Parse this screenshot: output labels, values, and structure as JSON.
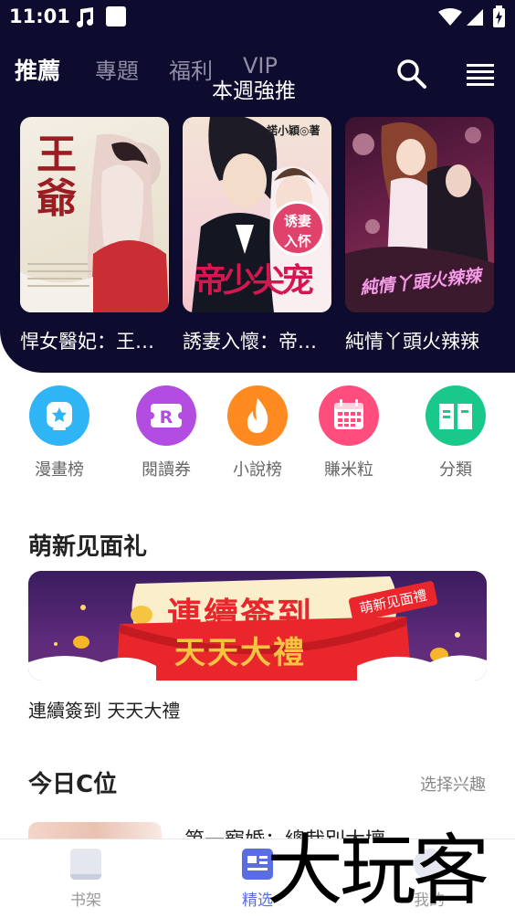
{
  "status_bar": {
    "time": "11:01"
  },
  "top_tabs": [
    {
      "label": "推薦",
      "active": true
    },
    {
      "label": "專題",
      "active": false
    },
    {
      "label": "福利",
      "active": false
    },
    {
      "label": "VIP",
      "active": false
    }
  ],
  "section_title": "本週強推",
  "featured_books": [
    {
      "title": "悍女醫妃：王爺別惹火"
    },
    {
      "title": "誘妻入懷：帝少尖寵"
    },
    {
      "title": "純情丫頭火辣辣"
    }
  ],
  "cover_text": {
    "book1": "王爺",
    "book2_author": "諾小穎◎著",
    "book2_badge_top": "诱妻",
    "book2_badge_bottom": "入怀",
    "book2_title": "帝少尖宠",
    "book3": "純情丫頭火辣辣"
  },
  "quick_links": [
    {
      "label": "漫畫榜",
      "color": "#2fb4f5",
      "icon": "comic-icon"
    },
    {
      "label": "閱讀券",
      "color": "#b34ce0",
      "icon": "ticket-icon"
    },
    {
      "label": "小說榜",
      "color": "#ff8a1f",
      "icon": "fire-icon"
    },
    {
      "label": "賺米粒",
      "color": "#ff4d7e",
      "icon": "calendar-icon"
    },
    {
      "label": "分類",
      "color": "#18c98b",
      "icon": "book-icon"
    }
  ],
  "welcome": {
    "heading": "萌新见面礼",
    "banner_main": "連續簽到",
    "banner_sub": "天天大禮",
    "banner_tag": "萌新见面禮",
    "caption": "連續簽到 天天大禮"
  },
  "today": {
    "heading": "今日C位",
    "link": "选择兴趣",
    "first_title": "第一寵婚：總裁別太壞"
  },
  "bottom_nav": [
    {
      "label": "书架",
      "icon": "bookshelf-icon",
      "active": false
    },
    {
      "label": "精选",
      "icon": "featured-icon",
      "active": true
    },
    {
      "label": "我的",
      "icon": "profile-icon",
      "active": false
    }
  ],
  "watermark": "大玩客",
  "colors": {
    "header_bg": "#0e0c2e",
    "active_nav": "#5b6ee1",
    "banner_red": "#e8262c"
  }
}
